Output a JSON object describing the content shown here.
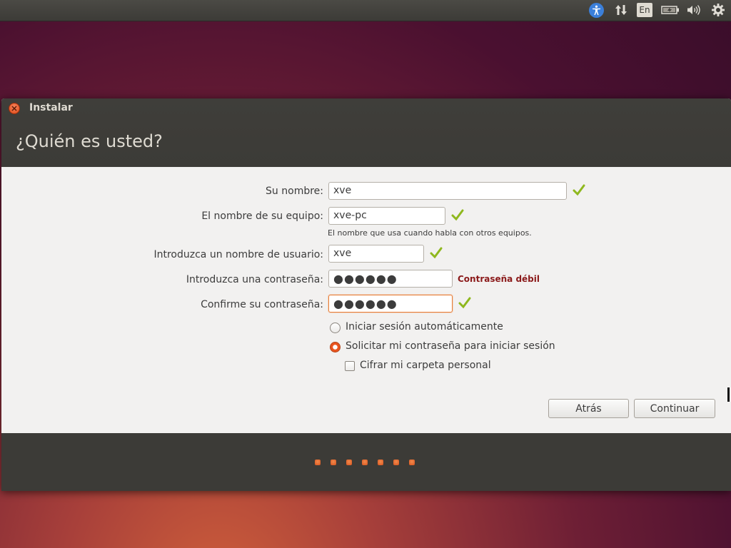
{
  "panel": {
    "language": "En",
    "icons": [
      "accessibility-icon",
      "network-icon",
      "keyboard-language-icon",
      "battery-icon",
      "volume-icon",
      "gear-icon"
    ]
  },
  "window": {
    "title": "Instalar",
    "heading": "¿Quién es usted?"
  },
  "form": {
    "name_label": "Su nombre:",
    "name_value": "xve",
    "computer_label": "El nombre de su equipo:",
    "computer_value": "xve-pc",
    "computer_hint": "El nombre que usa cuando habla con otros equipos.",
    "username_label": "Introduzca un nombre de usuario:",
    "username_value": "xve",
    "password_label": "Introduzca una contraseña:",
    "password_value": "●●●●●●",
    "password_strength": "Contraseña débil",
    "confirm_label": "Confirme su contraseña:",
    "confirm_value": "●●●●●●",
    "auto_login_label": "Iniciar sesión automáticamente",
    "require_password_label": "Solicitar mi contraseña para iniciar sesión",
    "encrypt_home_label": "Cifrar mi carpeta personal",
    "login_mode": "require_password",
    "encrypt_home": false
  },
  "buttons": {
    "back": "Atrás",
    "continue": "Continuar"
  },
  "progress": {
    "total_steps": 7
  },
  "colors": {
    "accent": "#e9541e",
    "check": "#8fb81e",
    "weak": "#8b1a1a",
    "dark": "#3c3b37"
  }
}
